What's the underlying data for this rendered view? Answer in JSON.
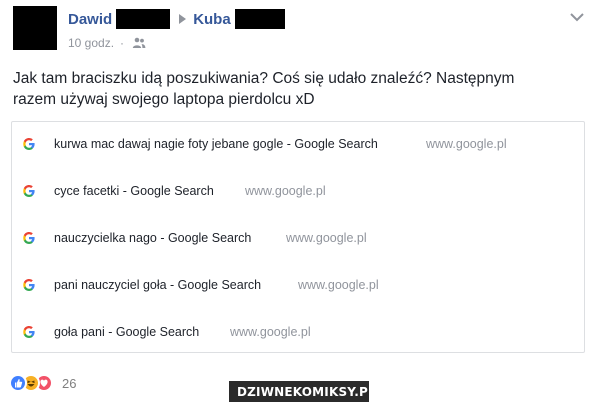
{
  "post": {
    "author": "Dawid",
    "recipient": "Kuba",
    "time": "10 godz.",
    "text_line1": "Jak tam braciszku idą poszukiwania? Coś się udało znaleźć? Następnym",
    "text_line2": "razem używaj swojego laptopa pierdolcu xD"
  },
  "history": [
    {
      "title": "kurwa mac dawaj nagie foty jebane gogle - Google Search",
      "url": "www.google.pl"
    },
    {
      "title": "cyce facetki - Google Search",
      "url": "www.google.pl"
    },
    {
      "title": "nauczycielka nago - Google Search",
      "url": "www.google.pl"
    },
    {
      "title": "pani nauczyciel goła - Google Search",
      "url": "www.google.pl"
    },
    {
      "title": "goła pani - Google Search",
      "url": "www.google.pl"
    }
  ],
  "reactions": {
    "count": "26",
    "types": [
      "like-icon",
      "haha-icon",
      "love-icon"
    ]
  },
  "watermark": {
    "text": "DZIWNEKOMIKSY.PL"
  },
  "colors": {
    "name": "#365899",
    "meta": "#90949c",
    "border": "#dddfe2"
  }
}
